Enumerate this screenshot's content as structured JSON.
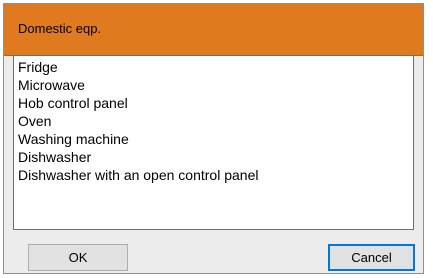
{
  "dialog": {
    "title": "Domestic eqp.",
    "items": [
      "Fridge",
      "Microwave",
      "Hob control panel",
      "Oven",
      "Washing machine",
      "Dishwasher",
      "Dishwasher with an open control panel"
    ],
    "ok_label": "OK",
    "cancel_label": "Cancel"
  },
  "colors": {
    "titlebar": "#e07a1f",
    "dialog_background": "#ececec",
    "focus_border": "#0078d7"
  }
}
